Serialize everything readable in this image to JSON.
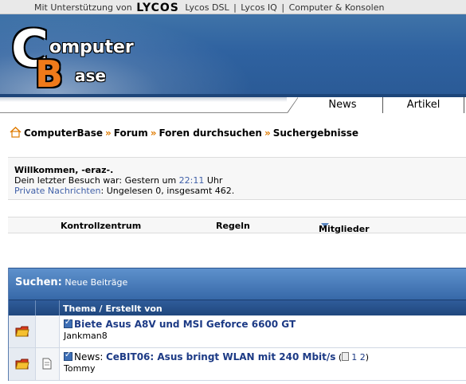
{
  "topbar": {
    "prefix": "Mit Unterstützung von",
    "brand": "LYCOS",
    "links": [
      "Lycos DSL",
      "Lycos IQ",
      "Computer & Konsolen"
    ],
    "separator": "|"
  },
  "logo": {
    "c": "C",
    "word1": "omputer",
    "b": "B",
    "word2": "ase"
  },
  "tabs": {
    "news": "News",
    "artikel": "Artikel"
  },
  "breadcrumb": {
    "items": [
      "ComputerBase",
      "Forum",
      "Foren durchsuchen",
      "Suchergebnisse"
    ],
    "separator": "»"
  },
  "welcome": {
    "hello": "Willkommen, -eraz-.",
    "last_visit_prefix": "Dein letzter Besuch war: Gestern um",
    "last_visit_time": "22:11",
    "last_visit_suffix": "Uhr",
    "pm_link": "Private Nachrichten",
    "pm_status": ": Ungelesen 0, insgesamt 462."
  },
  "navbar": {
    "kontrollzentrum": "Kontrollzentrum",
    "regeln": "Regeln",
    "mitglieder": "Mitglieder"
  },
  "results": {
    "header_label": "Suchen:",
    "header_value": "Neue Beiträge",
    "column_title": "Thema / Erstellt von",
    "rows": [
      {
        "prefix": "",
        "title": "Biete Asus A8V und MSI Geforce 6600 GT",
        "author": "Jankman8",
        "pages": []
      },
      {
        "prefix": "News:",
        "title": "CeBIT06: Asus bringt WLAN mit 240 Mbit/s",
        "author": "Tommy",
        "pages": [
          "1",
          "2"
        ]
      }
    ]
  },
  "colors": {
    "accent": "#2f62a0",
    "crumb_sep": "#e07b00",
    "link": "#1c3a85"
  }
}
